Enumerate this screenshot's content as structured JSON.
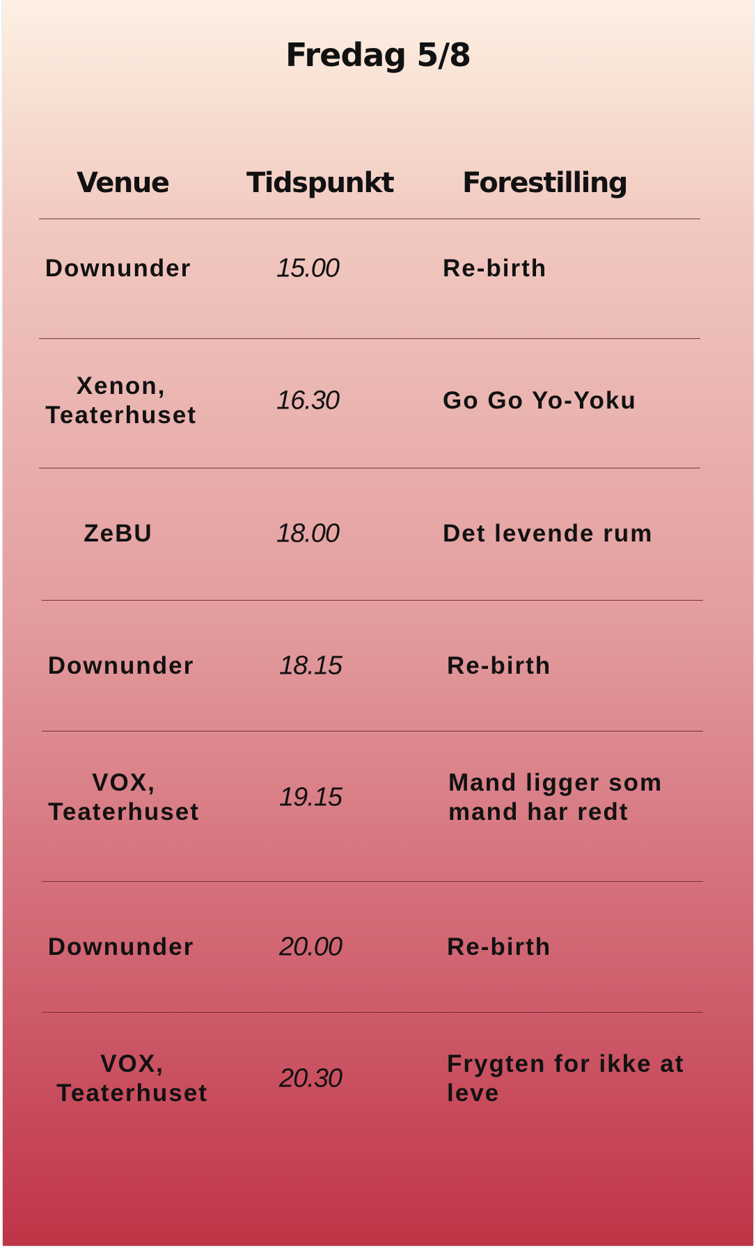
{
  "title": "Fredag 5/8",
  "headers": {
    "venue": "Venue",
    "time": "Tidspunkt",
    "show": "Forestilling"
  },
  "rows": [
    {
      "venue": "Downunder",
      "time": "15.00",
      "show": "Re-birth"
    },
    {
      "venue": "Xenon,\nTeaterhuset",
      "time": "16.30",
      "show": "Go Go Yo-Yoku"
    },
    {
      "venue": "ZeBU",
      "time": "18.00",
      "show": "Det levende rum"
    },
    {
      "venue": "Downunder",
      "time": "18.15",
      "show": "Re-birth"
    },
    {
      "venue": "VOX,\nTeaterhuset",
      "time": "19.15",
      "show": "Mand ligger som\nmand har redt"
    },
    {
      "venue": "Downunder",
      "time": "20.00",
      "show": "Re-birth"
    },
    {
      "venue": "VOX,\nTeaterhuset",
      "time": "20.30",
      "show": "Frygten for ikke at\nleve"
    }
  ],
  "colors": {
    "background_top": "#fdf1e3",
    "background_bottom": "#bf3447",
    "divider": "#7a2e35",
    "text": "#111111"
  }
}
